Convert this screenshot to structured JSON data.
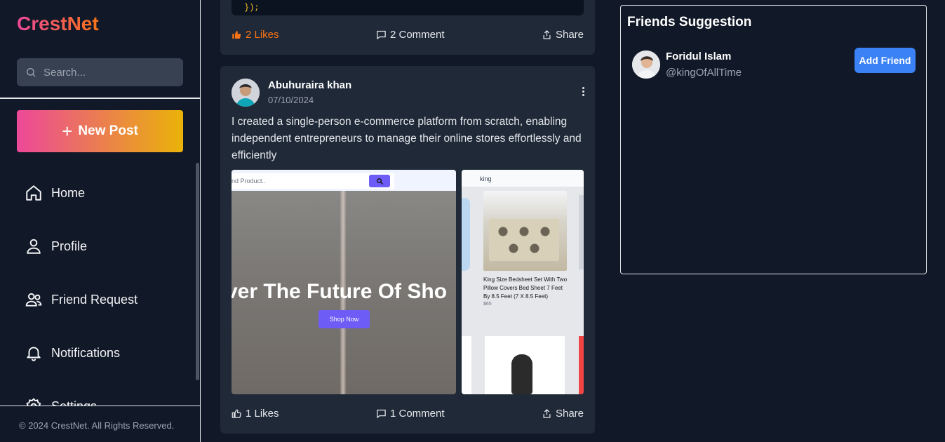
{
  "app": {
    "logo": "CrestNet"
  },
  "sidebar": {
    "search_placeholder": "Search...",
    "new_post_label": "New Post",
    "items": [
      {
        "label": "Home",
        "icon": "home-icon"
      },
      {
        "label": "Profile",
        "icon": "user-icon"
      },
      {
        "label": "Friend Request",
        "icon": "users-icon"
      },
      {
        "label": "Notifications",
        "icon": "bell-icon"
      },
      {
        "label": "Settings",
        "icon": "gear-icon"
      }
    ],
    "footer": "© 2024 CrestNet. All Rights Reserved."
  },
  "feed": {
    "post1": {
      "code_line": "});",
      "likes": "2 Likes",
      "comments": "2 Comment",
      "share": "Share"
    },
    "post2": {
      "author": "Abuhuraira khan",
      "date": "07/10/2024",
      "text": "I created a single-person e-commerce platform from scratch, enabling independent entrepreneurs to manage their online stores effortlessly and efficiently",
      "image1": {
        "search_placeholder": "nd Product..",
        "headline": "ver The Future Of Sho",
        "button": "Shop Now"
      },
      "image2": {
        "query": "king",
        "product_title": "King Size Bedsheet Set With Two Pillow Covers Bed Sheet 7 Feet By 8.5 Feet (7 X 8.5 Feet)",
        "product_price": "$65"
      },
      "likes": "1 Likes",
      "comments": "1 Comment",
      "share": "Share"
    }
  },
  "friends_suggestion": {
    "title": "Friends Suggestion",
    "friends": [
      {
        "name": "Foridul Islam",
        "handle": "@kingOfAllTime",
        "button": "Add Friend"
      }
    ]
  },
  "colors": {
    "background": "#111827",
    "card": "#1f2937",
    "accent_blue": "#3b82f6",
    "like_orange": "#f97316",
    "gradient_start": "#ec4899",
    "gradient_end": "#eab308"
  }
}
